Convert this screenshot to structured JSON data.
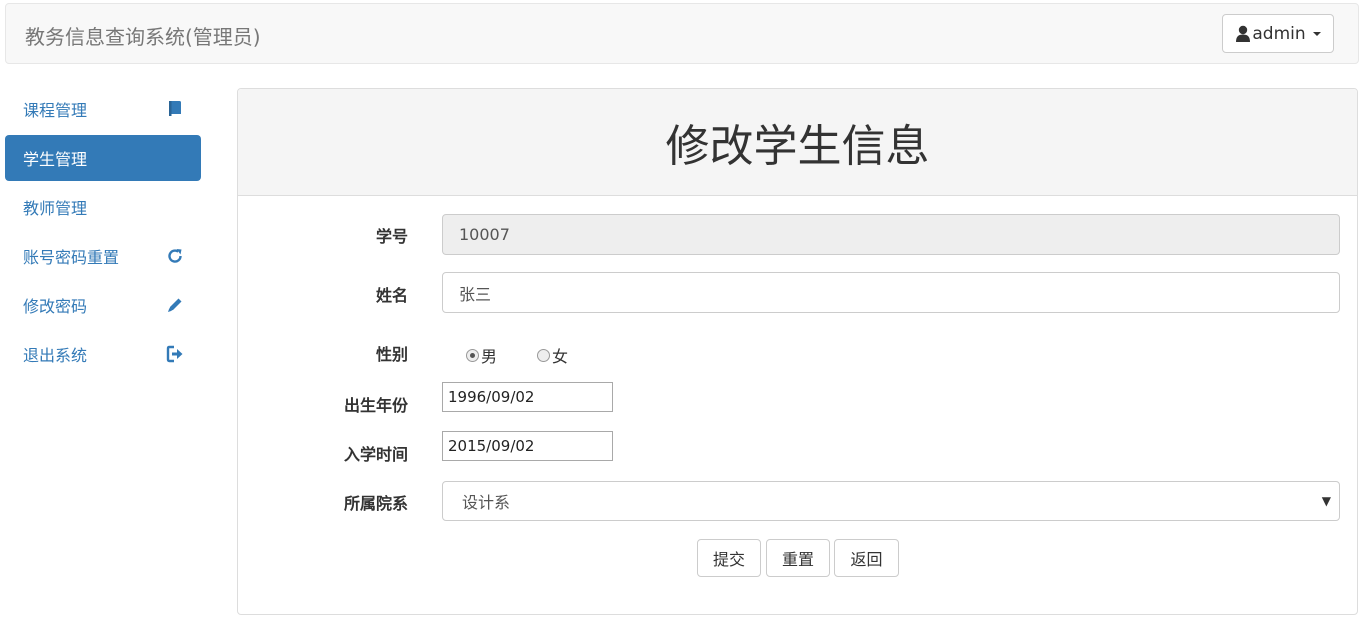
{
  "header": {
    "title": "教务信息查询系统(管理员)",
    "user_label": "admin"
  },
  "sidebar": {
    "items": [
      {
        "label": "课程管理",
        "icon": "book-icon",
        "active": false
      },
      {
        "label": "学生管理",
        "icon": "",
        "active": true
      },
      {
        "label": "教师管理",
        "icon": "",
        "active": false
      },
      {
        "label": "账号密码重置",
        "icon": "refresh-icon",
        "active": false
      },
      {
        "label": "修改密码",
        "icon": "pencil-icon",
        "active": false
      },
      {
        "label": "退出系统",
        "icon": "logout-icon",
        "active": false
      }
    ]
  },
  "form": {
    "title": "修改学生信息",
    "student_id": {
      "label": "学号",
      "value": "10007"
    },
    "name": {
      "label": "姓名",
      "value": "张三"
    },
    "gender": {
      "label": "性别",
      "options": [
        "男",
        "女"
      ],
      "selected": "男"
    },
    "birth": {
      "label": "出生年份",
      "value": "1996/09/02"
    },
    "enroll": {
      "label": "入学时间",
      "value": "2015/09/02"
    },
    "department": {
      "label": "所属院系",
      "value": "设计系"
    },
    "buttons": {
      "submit": "提交",
      "reset": "重置",
      "back": "返回"
    }
  },
  "colors": {
    "primary": "#337ab7",
    "navbar_bg": "#f8f8f8",
    "heading_bg": "#f5f5f5"
  }
}
